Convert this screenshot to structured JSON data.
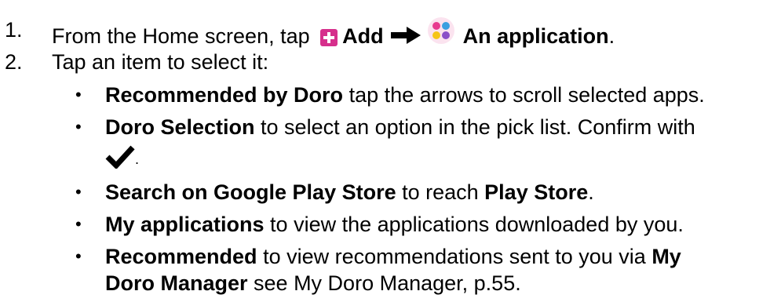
{
  "steps": [
    {
      "number": "1.",
      "prefix": "From the Home screen, tap ",
      "add_label": "Add",
      "app_label": "An application",
      "suffix": "."
    },
    {
      "number": "2.",
      "text": "Tap an item to select it:"
    }
  ],
  "items": [
    {
      "bullet": "•",
      "bold": "Recommended by Doro",
      "text": " tap the arrows to scroll selected apps."
    },
    {
      "bullet": "•",
      "bold": "Doro Selection",
      "text": " to select an option in the pick list. Confirm with"
    },
    {
      "tail": "."
    },
    {
      "bullet": "•",
      "bold": "Search on Google Play Store",
      "text": " to reach ",
      "bold2": "Play Store",
      "text2": "."
    },
    {
      "bullet": "•",
      "bold": "My applications",
      "text": " to view the applications downloaded by you."
    },
    {
      "bullet": "•",
      "bold": "Recommended",
      "text": " to view recommendations sent to you via ",
      "bold2": "My"
    },
    {
      "bold": "Doro Manager",
      "text": " see My Doro Manager, p.55."
    }
  ],
  "icons": {
    "add": "plus-icon",
    "apps": "apps-icon",
    "arrow": "arrow-right-icon",
    "confirm": "checkmark-icon"
  },
  "colors": {
    "add_icon": "#d62f8c",
    "apps_pink": "#e8398f",
    "apps_blue": "#3aa0e0",
    "apps_yellow": "#f5c518",
    "apps_purple": "#8b4fc8",
    "apps_bg": "#fbe3ef"
  }
}
